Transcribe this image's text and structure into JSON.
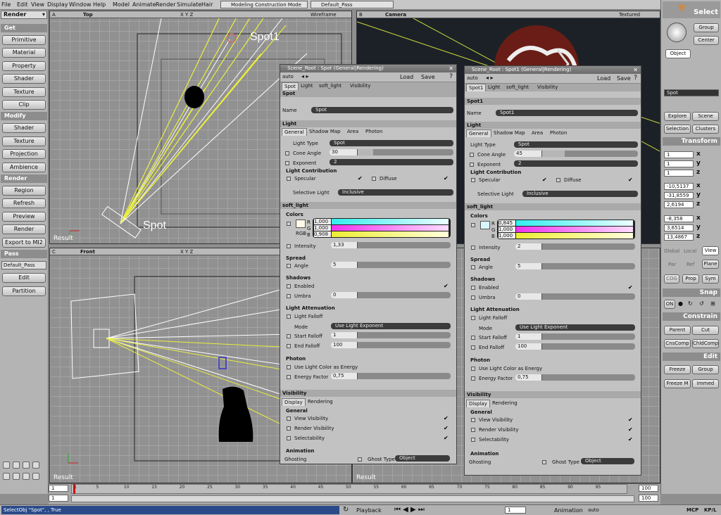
{
  "menubar": {
    "items": [
      "File",
      "Edit",
      "View",
      "Display",
      "Window",
      "Help",
      "Model",
      "Animate",
      "Render",
      "Simulate",
      "Hair"
    ],
    "mode": "Modeling Construction Mode",
    "pass": "Default_Pass"
  },
  "left_panel": {
    "module": "Render",
    "get_header": "Get",
    "get_items": [
      "Primitive",
      "Material",
      "Property",
      "Shader",
      "Texture",
      "Clip"
    ],
    "modify_header": "Modify",
    "modify_items": [
      "Shader",
      "Texture",
      "Projection",
      "Ambience"
    ],
    "render_header": "Render",
    "render_items": [
      "Region",
      "Refresh",
      "Preview",
      "Render",
      "Export to MI2"
    ],
    "pass_header": "Pass",
    "pass_value": "Default_Pass",
    "pass_items": [
      "Edit",
      "Partition"
    ]
  },
  "viewports": {
    "top": {
      "letter": "A",
      "name": "Top",
      "mode": "Wireframe",
      "xyz": "X Y Z",
      "labels": [
        "Spot1",
        "Spot"
      ],
      "result": "Result"
    },
    "camera": {
      "letter": "B",
      "name": "Camera",
      "mode": "Textured"
    },
    "front": {
      "letter": "C",
      "name": "Front",
      "xyz": "X Y Z",
      "result": "Result"
    },
    "d": {
      "result": "Result"
    }
  },
  "panel_spot": {
    "title": "Scene_Root : Spot (General|Rendering)",
    "auto": "auto",
    "load": "Load",
    "save": "Save",
    "tabs": [
      "Spot",
      "Light",
      "soft_light",
      "Visibility"
    ],
    "spot_section": "Spot",
    "name_label": "Name",
    "name_value": "Spot",
    "light_section": "Light",
    "light_tabs": [
      "General",
      "Shadow Map",
      "Area",
      "Photon"
    ],
    "light_type_label": "Light Type",
    "light_type_value": "Spot",
    "cone_angle_label": "Cone Angle",
    "cone_angle": "30",
    "exponent_label": "Exponent",
    "exponent": "2",
    "contribution": "Light Contribution",
    "specular": "Specular",
    "diffuse": "Diffuse",
    "selective_label": "Selective Light",
    "selective_value": "Inclusive",
    "soft_section": "soft_light",
    "colors_label": "Colors",
    "r_label": "R",
    "g_label": "G",
    "b_label": "B",
    "rgb_label": "RGB",
    "r": "1,000",
    "g": "1,000",
    "b": "0,908",
    "intensity_label": "Intensity",
    "intensity": "1,33",
    "spread_label": "Spread",
    "angle_label": "Angle",
    "angle": "5",
    "shadows_label": "Shadows",
    "enabled_label": "Enabled",
    "umbra_label": "Umbra",
    "umbra": "0",
    "atten_label": "Light Attenuation",
    "falloff_label": "Light Falloff",
    "mode_label": "Mode",
    "mode_value": "Use Light Exponent",
    "start_falloff_label": "Start Falloff",
    "start_falloff": "1",
    "end_falloff_label": "End Falloff",
    "end_falloff": "100",
    "photon_label": "Photon",
    "use_color_label": "Use Light Color as Energy",
    "energy_label": "Energy Factor",
    "energy": "0,75",
    "visibility_section": "Visibility",
    "vis_tabs": [
      "Display",
      "Rendering"
    ],
    "general_label": "General",
    "view_vis": "View Visibility",
    "render_vis": "Render Visibility",
    "selectability": "Selectability",
    "animation_label": "Animation",
    "ghosting": "Ghosting",
    "ghost_type_label": "Ghost Type",
    "ghost_type": "Object"
  },
  "panel_spot1": {
    "title": "Scene_Root : Spot1 (General|Rendering)",
    "auto": "auto",
    "load": "Load",
    "save": "Save",
    "tabs": [
      "Spot1",
      "Light",
      "soft_light",
      "Visibility"
    ],
    "spot_section": "Spot1",
    "name_label": "Name",
    "name_value": "Spot1",
    "light_section": "Light",
    "light_tabs": [
      "General",
      "Shadow Map",
      "Area",
      "Photon"
    ],
    "light_type_label": "Light Type",
    "light_type_value": "Spot",
    "cone_angle_label": "Cone Angle",
    "cone_angle": "45",
    "exponent_label": "Exponent",
    "exponent": "2",
    "contribution": "Light Contribution",
    "specular": "Specular",
    "diffuse": "Diffuse",
    "selective_label": "Selective Light",
    "selective_value": "Inclusive",
    "soft_section": "soft_light",
    "colors_label": "Colors",
    "r_label": "R",
    "g_label": "G",
    "b_label": "B",
    "r": "0,845",
    "g": "1,000",
    "b": "1,000",
    "intensity_label": "Intensity",
    "intensity": "2",
    "spread_label": "Spread",
    "angle_label": "Angle",
    "angle": "5",
    "shadows_label": "Shadows",
    "enabled_label": "Enabled",
    "umbra_label": "Umbra",
    "umbra": "0",
    "atten_label": "Light Attenuation",
    "falloff_label": "Light Falloff",
    "mode_label": "Mode",
    "mode_value": "Use Light Exponent",
    "start_falloff_label": "Start Falloff",
    "start_falloff": "1",
    "end_falloff_label": "End Falloff",
    "end_falloff": "100",
    "photon_label": "Photon",
    "use_color_label": "Use Light Color as Energy",
    "energy_label": "Energy Factor",
    "energy": "0,75",
    "visibility_section": "Visibility",
    "vis_tabs": [
      "Display",
      "Rendering"
    ],
    "general_label": "General",
    "view_vis": "View Visibility",
    "render_vis": "Render Visibility",
    "selectability": "Selectability",
    "animation_label": "Animation",
    "ghosting": "Ghosting",
    "ghost_type_label": "Ghost Type",
    "ghost_type": "Object"
  },
  "right_panel": {
    "select": "Select",
    "group": "Group",
    "center": "Center",
    "object": "Object",
    "selection_field": "Spot",
    "explore": "Explore",
    "scene": "Scene",
    "selection": "Selection",
    "clusters": "Clusters",
    "transform": "Transform",
    "scale": [
      "1",
      "1",
      "1"
    ],
    "rotation": [
      "-10,5137",
      "-31,8559",
      "2,6194"
    ],
    "translation": [
      "-8,358",
      "3,6514",
      "13,4867"
    ],
    "axis": [
      "x",
      "y",
      "z"
    ],
    "coord": [
      "Global",
      "Local",
      "View"
    ],
    "ref": [
      "Par",
      "Ref",
      "Plane"
    ],
    "cog": "COG",
    "prop": "Prop",
    "sym": "Sym",
    "snap": "Snap",
    "on": "ON",
    "constrain": "Constrain",
    "parent": "Parent",
    "cut": "Cut",
    "cnscomp": "CnsComp",
    "childcomp": "ChldComp",
    "edit": "Edit",
    "freeze": "Freeze",
    "edit_group": "Group",
    "freeze_m": "Freeze M",
    "immed": "Immed"
  },
  "timeline": {
    "start": "1",
    "start2": "1",
    "end": "100",
    "end2": "100",
    "ticks": [
      "1",
      "5",
      "10",
      "15",
      "20",
      "25",
      "30",
      "35",
      "40",
      "45",
      "50",
      "55",
      "60",
      "65",
      "70",
      "75",
      "80",
      "85",
      "90",
      "95"
    ]
  },
  "status": {
    "command": "SelectObj \"Spot\", , True",
    "playback": "Playback",
    "frame": "1",
    "animation": "Animation",
    "auto": "auto",
    "mcp": "MCP",
    "kpl": "KP/L"
  }
}
